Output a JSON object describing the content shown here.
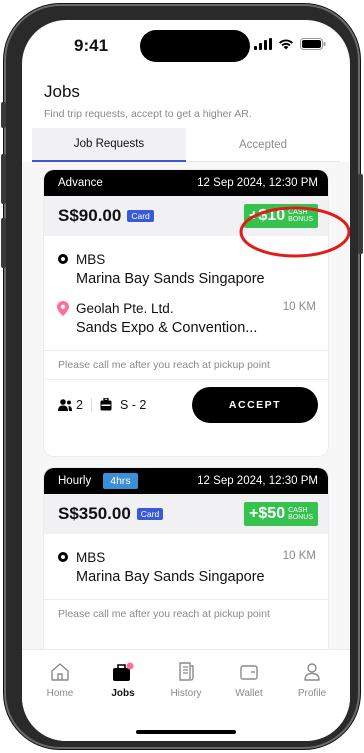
{
  "status_bar": {
    "time": "9:41"
  },
  "header": {
    "title": "Jobs",
    "subtitle": "Find trip requests, accept to get a higher AR."
  },
  "tabs": [
    {
      "label": "Job Requests",
      "active": true
    },
    {
      "label": "Accepted",
      "active": false
    }
  ],
  "cards": [
    {
      "type": "Advance",
      "datetime": "12 Sep 2024, 12:30 PM",
      "price": "S$90.00",
      "payment": "Card",
      "bonus_amount": "+$10",
      "bonus_label_1": "CASH",
      "bonus_label_2": "BONUS",
      "pickup_title": "MBS",
      "pickup_detail": "Marina Bay Sands Singapore",
      "dropoff_title": "Geolah Pte. Ltd.",
      "dropoff_detail": "Sands Expo & Convention...",
      "distance": "10 KM",
      "note": "Please call me after you reach at pickup point",
      "passengers": "2",
      "luggage": "S - 2",
      "accept_label": "ACCEPT"
    },
    {
      "type": "Hourly",
      "duration": "4hrs",
      "datetime": "12 Sep 2024, 12:30 PM",
      "price": "S$350.00",
      "payment": "Card",
      "bonus_amount": "+$50",
      "bonus_label_1": "CASH",
      "bonus_label_2": "BONUS",
      "pickup_title": "MBS",
      "pickup_detail": "Marina Bay Sands Singapore",
      "distance": "10 KM",
      "note": "Please call me after you reach at pickup point"
    }
  ],
  "nav": [
    {
      "label": "Home",
      "icon": "home-icon"
    },
    {
      "label": "Jobs",
      "icon": "briefcase-icon",
      "active": true
    },
    {
      "label": "History",
      "icon": "history-icon"
    },
    {
      "label": "Wallet",
      "icon": "wallet-icon"
    },
    {
      "label": "Profile",
      "icon": "profile-icon"
    }
  ],
  "colors": {
    "accent_blue": "#3a5bd9",
    "bonus_green": "#36c24f",
    "highlight_red": "#e01b1b",
    "nav_dot": "#ff6f91"
  }
}
